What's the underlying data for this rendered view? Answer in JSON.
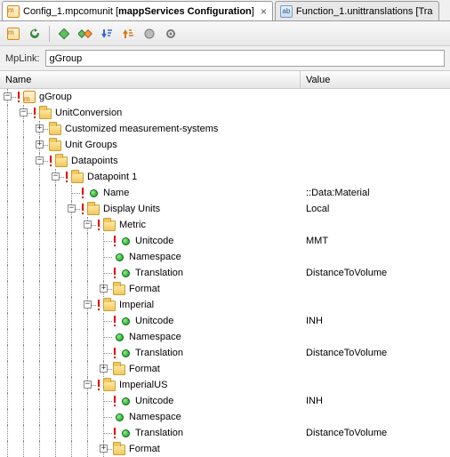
{
  "tabs": [
    {
      "file": "Config_1.mpcomunit",
      "title": "mappServices Configuration",
      "active": true
    },
    {
      "file": "Function_1.unittranslations",
      "title": "Tra",
      "active": false
    }
  ],
  "mplink": {
    "label": "MpLink:",
    "value": "gGroup"
  },
  "columns": {
    "name": "Name",
    "value": "Value"
  },
  "tree": {
    "root": "gGroup",
    "unitConversion": "UnitConversion",
    "custom": "Customized measurement-systems",
    "unitGroups": "Unit Groups",
    "datapoints": "Datapoints",
    "dp1": "Datapoint 1",
    "name": "Name",
    "nameVal": "::Data:Material",
    "displayUnits": "Display Units",
    "displayUnitsVal": "Local",
    "metric": "Metric",
    "imperial": "Imperial",
    "imperialUS": "ImperialUS",
    "unitcode": "Unitcode",
    "namespace": "Namespace",
    "translation": "Translation",
    "format": "Format",
    "vals": {
      "metric": {
        "unitcode": "MMT",
        "namespace": "",
        "translation": "DistanceToVolume"
      },
      "imperial": {
        "unitcode": "INH",
        "namespace": "",
        "translation": "DistanceToVolume"
      },
      "imperialUS": {
        "unitcode": "INH",
        "namespace": "",
        "translation": "DistanceToVolume"
      }
    }
  }
}
